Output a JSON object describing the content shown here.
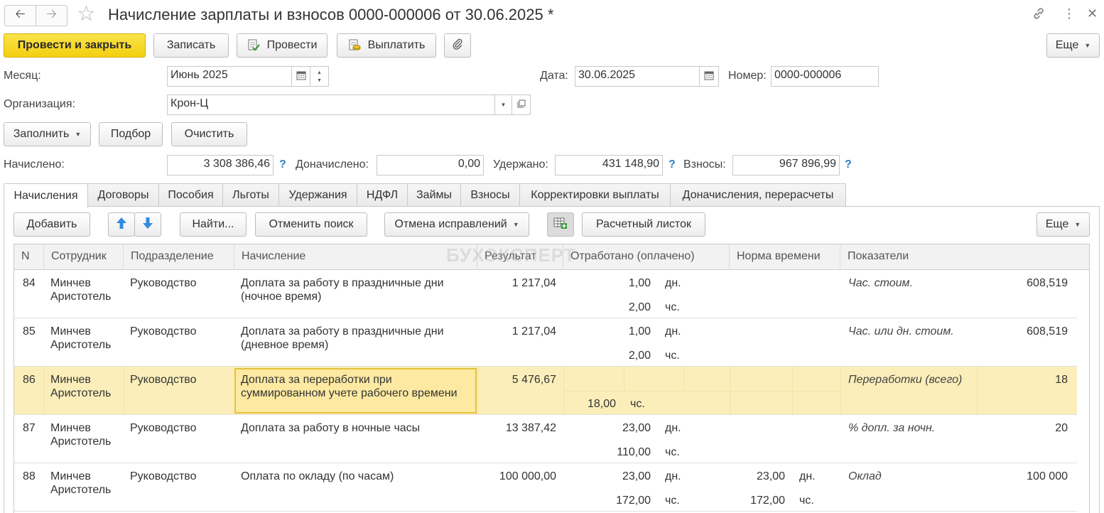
{
  "window": {
    "title": "Начисление зарплаты и взносов 0000-000006 от 30.06.2025 *",
    "icons": [
      "arrow-left-icon",
      "arrow-right-icon",
      "star-icon",
      "link-icon",
      "more-vertical-icon",
      "close-icon"
    ]
  },
  "toolbar": {
    "post_close": "Провести и закрыть",
    "save": "Записать",
    "post": "Провести",
    "pay": "Выплатить",
    "more": "Еще"
  },
  "form": {
    "month_label": "Месяц:",
    "month_value": "Июнь 2025",
    "date_label": "Дата:",
    "date_value": "30.06.2025",
    "number_label": "Номер:",
    "number_value": "0000-000006",
    "org_label": "Организация:",
    "org_value": "Крон-Ц",
    "fill": "Заполнить",
    "select": "Подбор",
    "clear": "Очистить"
  },
  "totals": {
    "accrued_label": "Начислено:",
    "accrued_value": "3 308 386,46",
    "extra_label": "Доначислено:",
    "extra_value": "0,00",
    "withheld_label": "Удержано:",
    "withheld_value": "431 148,90",
    "contrib_label": "Взносы:",
    "contrib_value": "967 896,99",
    "help": "?"
  },
  "tabs": [
    "Начисления",
    "Договоры",
    "Пособия",
    "Льготы",
    "Удержания",
    "НДФЛ",
    "Займы",
    "Взносы",
    "Корректировки выплаты",
    "Доначисления, перерасчеты"
  ],
  "grid_toolbar": {
    "add": "Добавить",
    "find": "Найти...",
    "cancel_search": "Отменить поиск",
    "cancel_fix": "Отмена исправлений",
    "payslip": "Расчетный листок",
    "more": "Еще"
  },
  "watermark": "БУХЭКСПЕРТ",
  "columns": [
    "N",
    "Сотрудник",
    "Подразделение",
    "Начисление",
    "Результат",
    "Отработано (оплачено)",
    "Норма времени",
    "Показатели"
  ],
  "rows": [
    {
      "n": "84",
      "emp1": "Минчев",
      "emp2": "Аристотель",
      "dept": "Руководство",
      "acc1": "Доплата за работу в праздничные дни",
      "acc2": "(ночное время)",
      "result": "1 217,04",
      "w1": "1,00",
      "u1": "дн.",
      "w2": "2,00",
      "u2": "чс.",
      "nm1": "",
      "nu1": "",
      "nm2": "",
      "nu2": "",
      "ind": "Час. стоим.",
      "indv": "608,519"
    },
    {
      "n": "85",
      "emp1": "Минчев",
      "emp2": "Аристотель",
      "dept": "Руководство",
      "acc1": "Доплата за работу в праздничные дни",
      "acc2": "(дневное время)",
      "result": "1 217,04",
      "w1": "1,00",
      "u1": "дн.",
      "w2": "2,00",
      "u2": "чс.",
      "nm1": "",
      "nu1": "",
      "nm2": "",
      "nu2": "",
      "ind": "Час. или дн. стоим.",
      "indv": "608,519"
    },
    {
      "n": "86",
      "emp1": "Минчев",
      "emp2": "Аристотель",
      "dept": "Руководство",
      "acc1": "Доплата за переработки при",
      "acc2": "суммированном учете рабочего времени",
      "result": "5 476,67",
      "w1": "",
      "u1": "",
      "w2": "18,00",
      "u2": "чс.",
      "nm1": "",
      "nu1": "",
      "nm2": "",
      "nu2": "",
      "ind": "Переработки (всего)",
      "indv": "18"
    },
    {
      "n": "87",
      "emp1": "Минчев",
      "emp2": "Аристотель",
      "dept": "Руководство",
      "acc1": "Доплата за работу в ночные часы",
      "acc2": "",
      "result": "13 387,42",
      "w1": "23,00",
      "u1": "дн.",
      "w2": "110,00",
      "u2": "чс.",
      "nm1": "",
      "nu1": "",
      "nm2": "",
      "nu2": "",
      "ind": "% допл. за ночн.",
      "indv": "20"
    },
    {
      "n": "88",
      "emp1": "Минчев",
      "emp2": "Аристотель",
      "dept": "Руководство",
      "acc1": "Оплата по окладу (по часам)",
      "acc2": "",
      "result": "100 000,00",
      "w1": "23,00",
      "u1": "дн.",
      "w2": "172,00",
      "u2": "чс.",
      "nm1": "23,00",
      "nu1": "дн.",
      "nm2": "172,00",
      "nu2": "чс.",
      "ind": "Оклад",
      "indv": "100 000"
    }
  ]
}
